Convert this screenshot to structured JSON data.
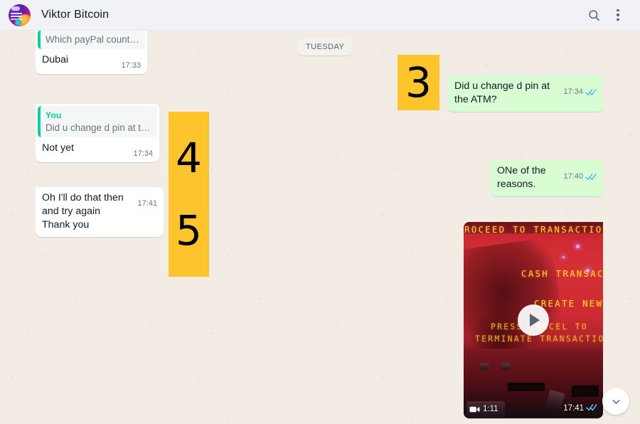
{
  "header": {
    "contact_name": "Viktor Bitcoin",
    "avatar_name": "contact-avatar",
    "search_icon": "search-icon",
    "menu_icon": "overflow-menu-icon"
  },
  "chat": {
    "date_divider": "TUESDAY",
    "messages": [
      {
        "id": "msg-dubai",
        "side": "in",
        "quoted_author": "",
        "quoted_text": "Which payPal country?",
        "text": "Dubai",
        "time": "17:33",
        "ticks": "none"
      },
      {
        "id": "msg-did-u-change-pin",
        "side": "out",
        "text": "Did u change d pin at the ATM?",
        "time": "17:34",
        "ticks": "read"
      },
      {
        "id": "msg-not-yet",
        "side": "in",
        "quoted_author": "You",
        "quoted_text": "Did u change d pin at the ATM?",
        "text": "Not yet",
        "time": "17:34",
        "ticks": "none"
      },
      {
        "id": "msg-one-of-the-reasons",
        "side": "out",
        "text": "ONe of the reasons.",
        "time": "17:40",
        "ticks": "read"
      },
      {
        "id": "msg-oh-ill-do-that",
        "side": "in",
        "text": "Oh I'll do that then and try again\nThank you",
        "time": "17:41",
        "ticks": "none"
      }
    ],
    "video_message": {
      "id": "msg-video-atm",
      "side": "out",
      "duration": "1:11",
      "time": "17:41",
      "ticks": "read",
      "camera_icon": "video-camera-icon",
      "play_icon": "play-icon",
      "thumbnail_text": [
        "ROCEED TO TRANSACTION",
        "CASH TRANSACT",
        "CREATE NEW",
        "PRESS CANCEL TO",
        "TERMINATE TRANSACTION"
      ]
    }
  },
  "annotations": [
    {
      "id": "anno-3",
      "label": "3"
    },
    {
      "id": "anno-4",
      "label": "4"
    },
    {
      "id": "anno-5",
      "label": "5"
    }
  ],
  "scroll_button": {
    "icon": "chevron-down-icon"
  },
  "colors": {
    "chat_background": "#f2ece5",
    "header_background": "#f0f2f5",
    "outgoing_bubble": "#d9fdd3",
    "incoming_bubble": "#ffffff",
    "annotation_yellow": "#fdc52b",
    "reply_accent": "#06cf9c",
    "tick_read": "#53bdeb"
  }
}
